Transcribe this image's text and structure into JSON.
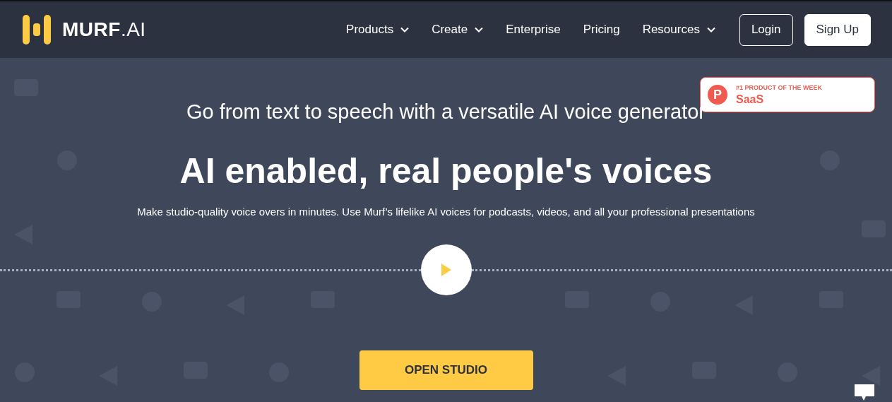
{
  "brand": {
    "name": "MURF",
    "suffix": ".AI"
  },
  "nav": [
    {
      "label": "Products",
      "dropdown": true
    },
    {
      "label": "Create",
      "dropdown": true
    },
    {
      "label": "Enterprise",
      "dropdown": false
    },
    {
      "label": "Pricing",
      "dropdown": false
    },
    {
      "label": "Resources",
      "dropdown": true
    }
  ],
  "auth": [
    {
      "label": "Login",
      "kind": "outline"
    },
    {
      "label": "Sign Up",
      "kind": "solid"
    }
  ],
  "badge": {
    "letter": "P",
    "caption": "#1 PRODUCT OF THE WEEK",
    "category": "SaaS"
  },
  "hero": {
    "tagline": "Go from text to speech with a versatile AI voice generator",
    "title": "AI enabled, real people's voices",
    "subtitle": "Make studio-quality voice overs in minutes. Use Murf’s lifelike AI voices for podcasts, videos, and all your professional presentations",
    "cta": "OPEN STUDIO"
  }
}
